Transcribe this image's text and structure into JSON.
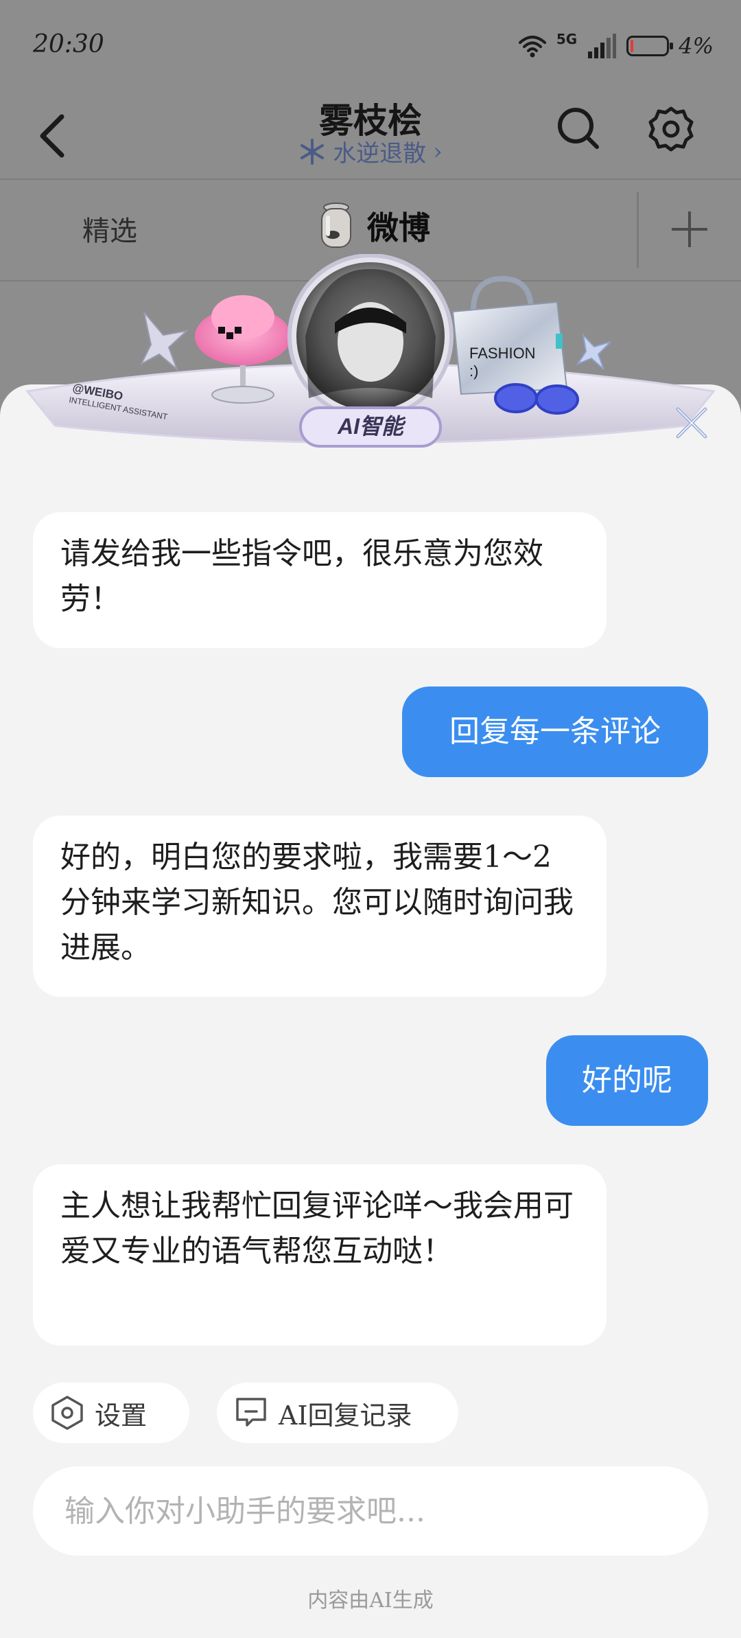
{
  "status_bar": {
    "time": "20:30",
    "network": "5G",
    "battery_percent": "4%",
    "battery_level": 0.04
  },
  "header": {
    "title": "雾枝桧",
    "subtitle": "水逆退散",
    "subtitle_chevron": "›",
    "subtitle_icon": "snowflake-icon"
  },
  "tabs": [
    {
      "label": "精选",
      "active": false
    },
    {
      "label": "微博",
      "active": true
    }
  ],
  "banner": {
    "watermark_line1": "@WEIBO",
    "watermark_line2": "INTELLIGENT ASSISTANT",
    "bag_text": "FASHION",
    "bag_face": ":)",
    "badge": "AI智能"
  },
  "chat": {
    "messages": [
      {
        "role": "assistant",
        "text": "请发给我一些指令吧，很乐意为您效劳！"
      },
      {
        "role": "user",
        "text": "回复每一条评论"
      },
      {
        "role": "assistant",
        "text": "好的，明白您的要求啦，我需要1～2分钟来学习新知识。您可以随时询问我进展。"
      },
      {
        "role": "user",
        "text": "好的呢"
      },
      {
        "role": "assistant",
        "text": "主人想让我帮忙回复评论咩～我会用可爱又专业的语气帮您互动哒！"
      }
    ]
  },
  "actions": {
    "settings_label": "设置",
    "history_label": "AI回复记录"
  },
  "input": {
    "placeholder": "输入你对小助手的要求吧..."
  },
  "footer_note": "内容由AI生成",
  "colors": {
    "accent_blue": "#3b8ef0",
    "panel_bg": "#f3f3f4",
    "dim_overlay": "#8d8d8d",
    "battery_low": "#e23b3b"
  }
}
